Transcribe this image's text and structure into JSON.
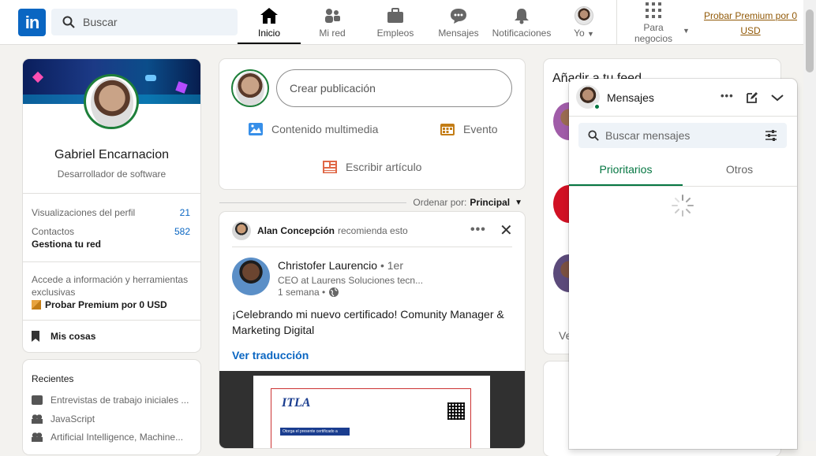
{
  "nav": {
    "search_placeholder": "Buscar",
    "items": [
      {
        "label": "Inicio",
        "icon": "home-icon",
        "active": true
      },
      {
        "label": "Mi red",
        "icon": "network-icon"
      },
      {
        "label": "Empleos",
        "icon": "briefcase-icon"
      },
      {
        "label": "Mensajes",
        "icon": "chat-icon"
      },
      {
        "label": "Notificaciones",
        "icon": "bell-icon"
      },
      {
        "label": "Yo",
        "icon": "avatar"
      }
    ],
    "business_label_1": "Para",
    "business_label_2": "negocios",
    "premium_link": "Probar Premium por 0 USD"
  },
  "profile": {
    "name": "Gabriel Encarnacion",
    "headline": "Desarrollador de software",
    "views_label": "Visualizaciones del perfil",
    "views_value": "21",
    "contacts_label": "Contactos",
    "contacts_value": "582",
    "manage_network": "Gestiona tu red",
    "premium_text": "Accede a información y herramientas exclusivas",
    "premium_cta": "Probar Premium por 0 USD",
    "my_items": "Mis cosas"
  },
  "recent": {
    "title": "Recientes",
    "items": [
      "Entrevistas de trabajo iniciales ...",
      "JavaScript",
      "Artificial Intelligence, Machine..."
    ]
  },
  "composer": {
    "placeholder": "Crear publicación",
    "media": "Contenido multimedia",
    "event": "Evento",
    "article": "Escribir artículo"
  },
  "sort": {
    "label": "Ordenar por:",
    "value": "Principal"
  },
  "post": {
    "recommender": "Alan Concepción",
    "recommends": "recomienda esto",
    "author": "Christofer Laurencio",
    "degree": "• 1er",
    "subtitle": "CEO at Laurens Soluciones tecn...",
    "time": "1 semana •",
    "text": "¡Celebrando mi nuevo certificado! Comunity Manager & Marketing Digital",
    "translate": "Ver traducción",
    "cert_logo": "ITLA",
    "cert_line": "Otorga el presente certificado a"
  },
  "right": {
    "feed_title": "Añadir a tu feed",
    "partial_text": "Ve"
  },
  "messaging": {
    "title": "Mensajes",
    "search_placeholder": "Buscar mensajes",
    "tab_focused": "Prioritarios",
    "tab_other": "Otros"
  },
  "colors": {
    "brand": "#0a66c2",
    "green": "#057642",
    "premium": "#915907"
  }
}
